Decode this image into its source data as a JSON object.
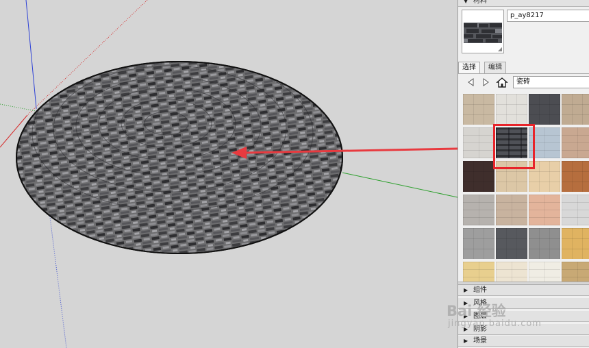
{
  "tray": {
    "materials": {
      "title": "材料",
      "name_value": "p_ay8217"
    },
    "tabs": [
      {
        "label": "选择"
      },
      {
        "label": "编辑"
      }
    ],
    "library_select": "瓷砖",
    "swatches": [
      [
        "#c9b9a2",
        "#e2e0db",
        "#4c4d52",
        "#c0ab92"
      ],
      [
        "#d6d4d0",
        "#4f5157",
        "#b7c5d2",
        "#c9a891"
      ],
      [
        "#3f2e2c",
        "#dcc7a6",
        "#e8cfa8",
        "#b66e3e"
      ],
      [
        "#b6b2ae",
        "#c8b39f",
        "#e3b49b",
        "#d8d8d8"
      ],
      [
        "#9e9e9e",
        "#57595e",
        "#8f8f8f",
        "#e0b361"
      ],
      [
        "#e8cf8e",
        "#ede4d2",
        "#f0ede4",
        "#c8a975"
      ]
    ],
    "selected_swatch": {
      "row": 1,
      "col": 1
    },
    "panels": [
      "组件",
      "风格",
      "图层",
      "阴影",
      "场景"
    ]
  },
  "watermark": {
    "brand": "Bai 经验",
    "url": "jingyan.baidu.com"
  },
  "colors": {
    "highlight": "#e8242a",
    "annotation_arrow": "#e83a3f",
    "axis_red": "#d62a2a",
    "axis_green": "#2ea02e",
    "axis_blue": "#2b3fd6"
  }
}
